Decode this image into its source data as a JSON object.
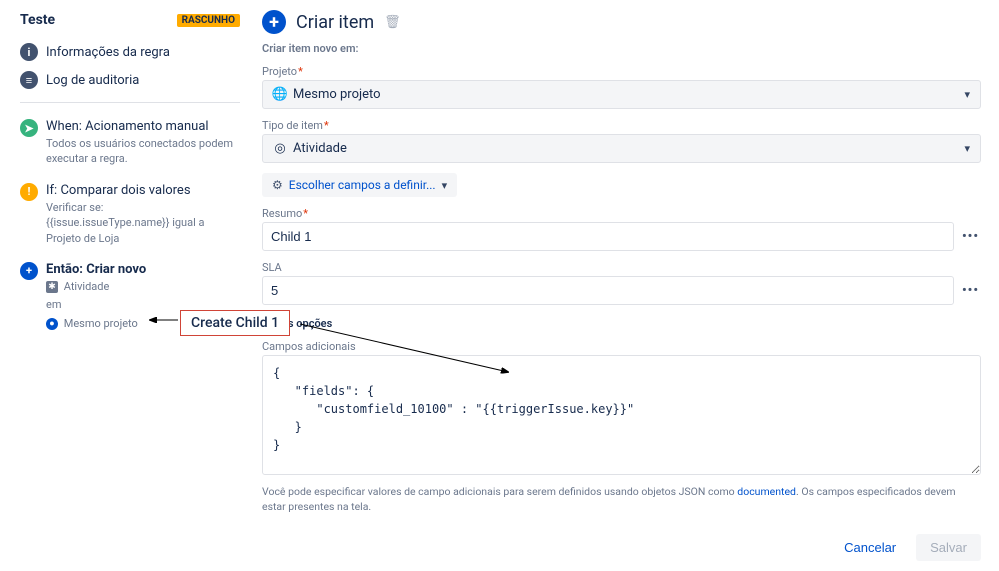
{
  "rule": {
    "name": "Teste",
    "draft_badge": "RASCUNHO",
    "nav": {
      "info": "Informações da regra",
      "audit": "Log de auditoria"
    },
    "steps": {
      "trigger": {
        "title_prefix": "When:",
        "title": "Acionamento manual",
        "desc": "Todos os usuários conectados podem executar a regra."
      },
      "condition": {
        "title_prefix": "If:",
        "title": "Comparar dois valores",
        "line1": "Verificar se:",
        "line2": "{{issue.issueType.name}} igual a Projeto de Loja"
      },
      "action": {
        "title_prefix": "Então:",
        "title": "Criar novo",
        "type": "Atividade",
        "in": "em",
        "project": "Mesmo projeto"
      }
    }
  },
  "panel": {
    "title": "Criar item",
    "subtitle": "Criar item novo em:",
    "project_label": "Projeto",
    "project_value": "Mesmo projeto",
    "itemtype_label": "Tipo de item",
    "itemtype_value": "Atividade",
    "choose_fields": "Escolher campos a definir...",
    "summary_label": "Resumo",
    "summary_value": "Child 1",
    "sla_label": "SLA",
    "sla_value": "5",
    "more_options": "Mais opções",
    "additional_fields_label": "Campos adicionais",
    "additional_fields_value": "{\n   \"fields\": {\n      \"customfield_10100\" : \"{{triggerIssue.key}}\"\n   }\n}",
    "help_text_1": "Você pode especificar valores de campo adicionais para serem definidos usando objetos JSON como ",
    "help_link": "documented",
    "help_text_2": ". Os campos especificados devem estar presentes na tela.",
    "cancel": "Cancelar",
    "save": "Salvar"
  },
  "annotation": {
    "label": "Create Child 1"
  }
}
